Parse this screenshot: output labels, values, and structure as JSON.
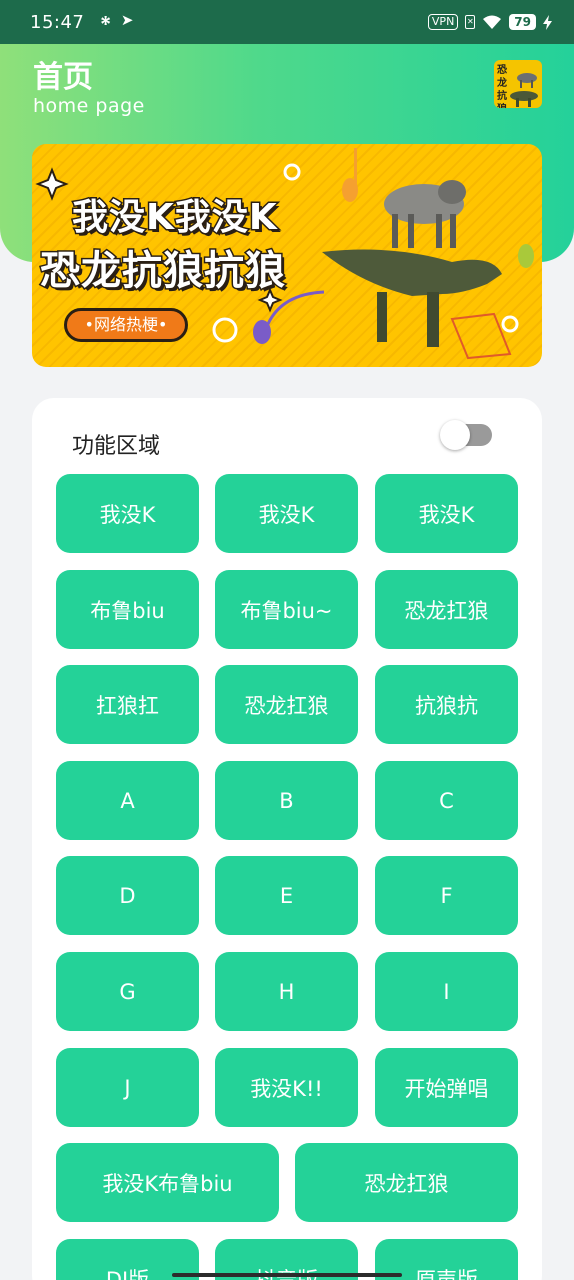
{
  "status_bar": {
    "time": "15:47",
    "usb_icon": "usb-icon",
    "location_icon": "location-arrow-icon",
    "vpn_label": "VPN",
    "battery": "79",
    "charging_icon": "bolt-icon"
  },
  "header": {
    "title": "首页",
    "subtitle": "home page",
    "logo_text": "恐龙抗狼"
  },
  "banner": {
    "line1": "我没K我没K",
    "line2": "恐龙抗狼抗狼",
    "tag": "•网络热梗•"
  },
  "function_area": {
    "title": "功能区域",
    "toggle_on": false,
    "buttons": [
      "我没K",
      "我没K",
      "我没K",
      "布鲁biu",
      "布鲁biu~",
      "恐龙扛狼",
      "扛狼扛",
      "恐龙扛狼",
      "抗狼抗",
      "A",
      "B",
      "C",
      "D",
      "E",
      "F",
      "G",
      "H",
      "I",
      "J",
      "我没K!!",
      "开始弹唱",
      "我没K布鲁biu",
      "恐龙扛狼",
      "DJ版",
      "抖音版",
      "原声版"
    ]
  },
  "colors": {
    "accent": "#24d298",
    "banner_yellow": "#ffc400",
    "status_bar": "#1d6b4b"
  }
}
